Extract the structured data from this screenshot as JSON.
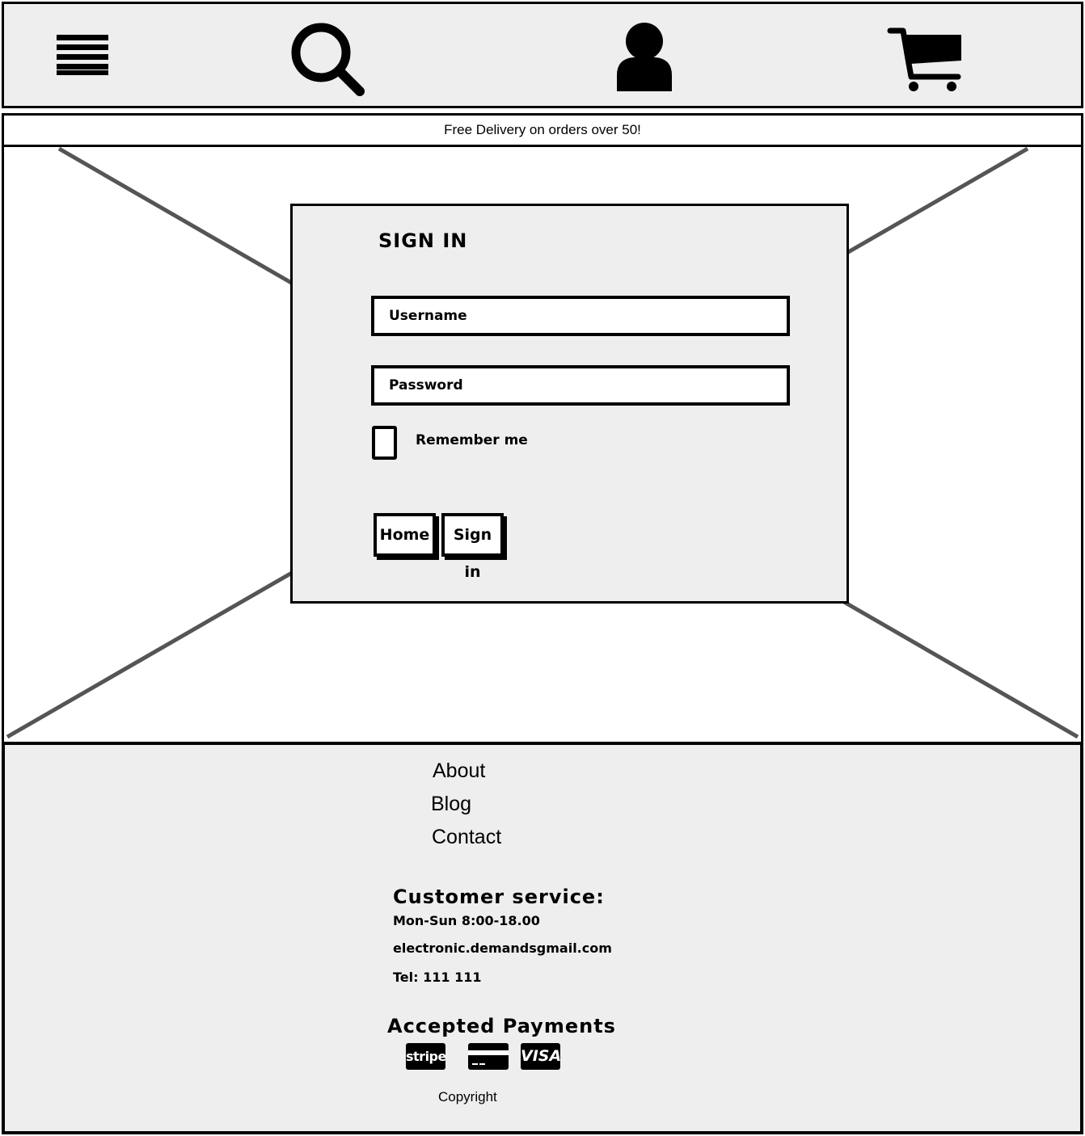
{
  "header": {
    "menu_icon": "menu-icon",
    "search_icon": "search-icon",
    "account_icon": "user-icon",
    "cart_icon": "cart-icon"
  },
  "banner": {
    "text": "Free Delivery on orders over 50!"
  },
  "signin": {
    "title": "SIGN IN",
    "username_placeholder": "Username",
    "password_placeholder": "Password",
    "remember_label": "Remember me",
    "home_button": "Home",
    "signin_button": "Sign in"
  },
  "footer": {
    "links": [
      "About",
      "Blog",
      "Contact"
    ],
    "customer_service": {
      "title": "Customer service:",
      "hours": "Mon-Sun 8:00-18.00",
      "email": "electronic.demandsgmail.com",
      "tel": "Tel: 111 111"
    },
    "payments": {
      "title": "Accepted Payments",
      "methods": [
        "stripe",
        "credit-card",
        "VISA"
      ]
    },
    "copyright": "Copyright"
  },
  "colors": {
    "panel": "#eeeeee",
    "border": "#000000",
    "line": "#555555"
  }
}
